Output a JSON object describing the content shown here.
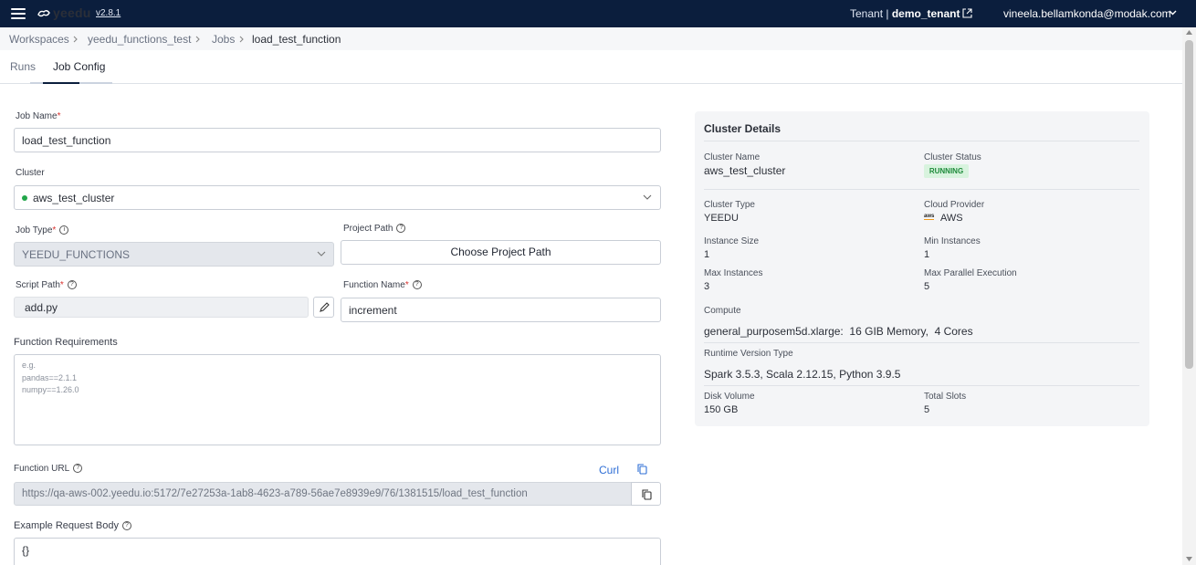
{
  "app": {
    "name": "yeedu",
    "version": "v2.8.1",
    "tenant_label": "Tenant |",
    "tenant": "demo_tenant",
    "user": "vineela.bellamkonda@modak.com"
  },
  "breadcrumb": [
    "Workspaces",
    "yeedu_functions_test",
    "Jobs",
    "load_test_function"
  ],
  "tabs": [
    "Runs",
    "Job Config"
  ],
  "form": {
    "job_name_label": "Job Name",
    "job_name": "load_test_function",
    "cluster_label": "Cluster",
    "cluster": "aws_test_cluster",
    "job_type_label": "Job Type",
    "job_type": "YEEDU_FUNCTIONS",
    "project_path_label": "Project Path",
    "choose_project_path": "Choose Project Path",
    "script_path_label": "Script Path",
    "script_path": "add.py",
    "function_name_label": "Function Name",
    "function_name": "increment",
    "requirements_label": "Function Requirements",
    "requirements_placeholder": [
      "e.g.",
      "pandas==2.1.1",
      "numpy==1.26.0"
    ],
    "function_url_label": "Function URL",
    "curl": "Curl",
    "function_url": "https://qa-aws-002.yeedu.io:5172/7e27253a-1ab8-4623-a789-56ae7e8939e9/76/1381515/load_test_function",
    "example_body_label": "Example Request Body",
    "example_body": "{}",
    "required_mark": "*"
  },
  "cluster_details": {
    "title": "Cluster Details",
    "cluster_name_label": "Cluster Name",
    "cluster_name": "aws_test_cluster",
    "cluster_status_label": "Cluster Status",
    "cluster_status": "RUNNING",
    "cluster_type_label": "Cluster Type",
    "cluster_type": "YEEDU",
    "cloud_provider_label": "Cloud Provider",
    "cloud_provider": "AWS",
    "cloud_logo": "aws",
    "instance_size_label": "Instance Size",
    "instance_size": "1",
    "min_instances_label": "Min Instances",
    "min_instances": "1",
    "max_instances_label": "Max Instances",
    "max_instances": "3",
    "max_parallel_label": "Max Parallel Execution",
    "max_parallel": "5",
    "compute_label": "Compute",
    "compute": "general_purposem5d.xlarge:  16 GIB Memory,  4 Cores",
    "runtime_label": "Runtime Version Type",
    "runtime": "Spark 3.5.3, Scala 2.12.15, Python 3.9.5",
    "disk_label": "Disk Volume",
    "disk": "150 GB",
    "slots_label": "Total Slots",
    "slots": "5"
  },
  "colors": {
    "topbar": "#0b1e3d",
    "status_green": "#1d8a3a",
    "link_blue": "#2f6fd6"
  }
}
